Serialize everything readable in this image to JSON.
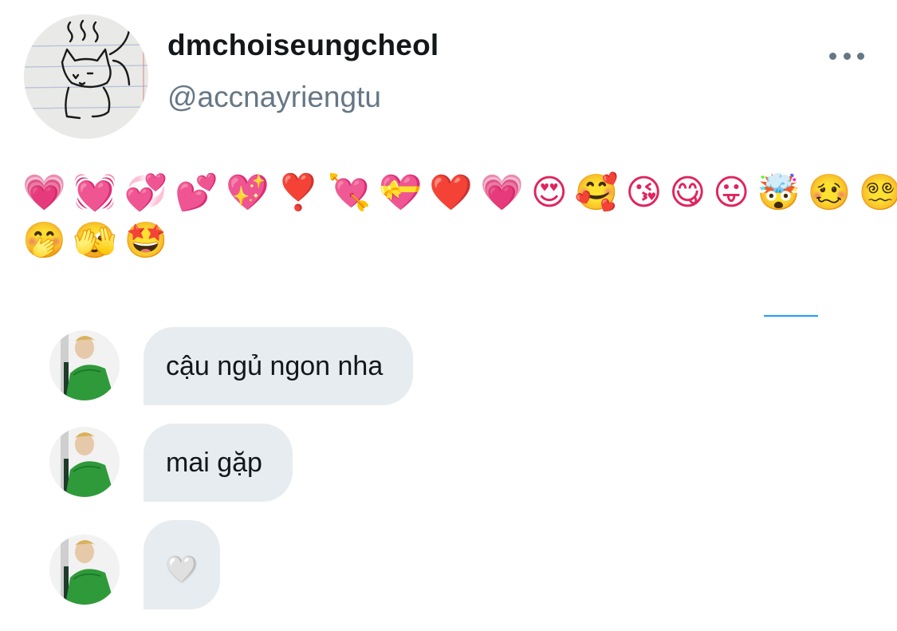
{
  "profile": {
    "display_name": "dmchoiseungcheol",
    "handle": "@accnayriengtu",
    "avatar_icon": "cat-doodle-avatar"
  },
  "more_icon": "more-horizontal-icon",
  "bio": {
    "line1": "💗💓💞💕💖❣️💘💝❤️💗😍🥰😘😋😛🤯🥴😵‍💫",
    "line2": "🤭🫣🤩"
  },
  "colors": {
    "bubble": "#e6ecf0",
    "handle": "#657786",
    "accent": "#1da1f2"
  },
  "messages": [
    {
      "text": "cậu ngủ ngon nha",
      "avatar_icon": "person-green-shirt-avatar"
    },
    {
      "text": "mai gặp",
      "avatar_icon": "person-green-shirt-avatar"
    },
    {
      "text": "🤍",
      "avatar_icon": "person-green-shirt-avatar"
    }
  ]
}
